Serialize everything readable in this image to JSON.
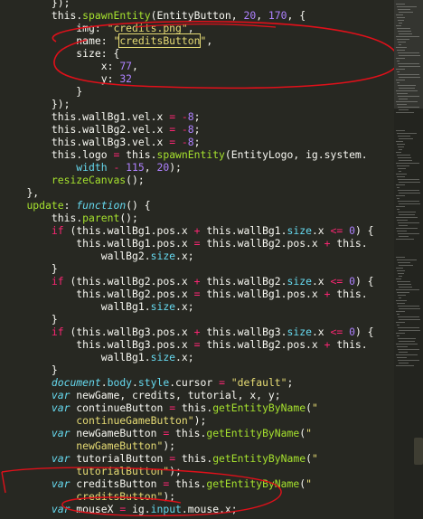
{
  "editor": {
    "lines": [
      {
        "indent": "        ",
        "tokens": [
          [
            "text",
            "});"
          ]
        ]
      },
      {
        "indent": "        ",
        "tokens": [
          [
            "this",
            "this"
          ],
          [
            "text",
            "."
          ],
          [
            "func",
            "spawnEntity"
          ],
          [
            "text",
            "(EntityButton, "
          ],
          [
            "number",
            "20"
          ],
          [
            "text",
            ", "
          ],
          [
            "number",
            "170"
          ],
          [
            "text",
            ", {"
          ]
        ]
      },
      {
        "indent": "            ",
        "tokens": [
          [
            "text",
            "img: "
          ],
          [
            "string",
            "\"credits.png\""
          ],
          [
            "text",
            ","
          ]
        ]
      },
      {
        "indent": "            ",
        "tokens": [
          [
            "text",
            "name: "
          ],
          [
            "string",
            "\""
          ],
          [
            "stringbox",
            "creditsButton"
          ],
          [
            "string",
            "\""
          ],
          [
            "text",
            ","
          ]
        ]
      },
      {
        "indent": "            ",
        "tokens": [
          [
            "text",
            "size: {"
          ]
        ]
      },
      {
        "indent": "                ",
        "tokens": [
          [
            "text",
            "x: "
          ],
          [
            "number",
            "77"
          ],
          [
            "text",
            ","
          ]
        ]
      },
      {
        "indent": "                ",
        "tokens": [
          [
            "text",
            "y: "
          ],
          [
            "number",
            "32"
          ]
        ]
      },
      {
        "indent": "            ",
        "tokens": [
          [
            "text",
            "}"
          ]
        ]
      },
      {
        "indent": "        ",
        "tokens": [
          [
            "text",
            "});"
          ]
        ]
      },
      {
        "indent": "        ",
        "tokens": [
          [
            "this",
            "this"
          ],
          [
            "text",
            ".wallBg1.vel.x "
          ],
          [
            "keyword",
            "="
          ],
          [
            "text",
            " "
          ],
          [
            "keyword",
            "-"
          ],
          [
            "number",
            "8"
          ],
          [
            "text",
            ";"
          ]
        ]
      },
      {
        "indent": "        ",
        "tokens": [
          [
            "this",
            "this"
          ],
          [
            "text",
            ".wallBg2.vel.x "
          ],
          [
            "keyword",
            "="
          ],
          [
            "text",
            " "
          ],
          [
            "keyword",
            "-"
          ],
          [
            "number",
            "8"
          ],
          [
            "text",
            ";"
          ]
        ]
      },
      {
        "indent": "        ",
        "tokens": [
          [
            "this",
            "this"
          ],
          [
            "text",
            ".wallBg3.vel.x "
          ],
          [
            "keyword",
            "="
          ],
          [
            "text",
            " "
          ],
          [
            "keyword",
            "-"
          ],
          [
            "number",
            "8"
          ],
          [
            "text",
            ";"
          ]
        ]
      },
      {
        "indent": "        ",
        "tokens": [
          [
            "this",
            "this"
          ],
          [
            "text",
            ".logo "
          ],
          [
            "keyword",
            "="
          ],
          [
            "text",
            " "
          ],
          [
            "this",
            "this"
          ],
          [
            "text",
            "."
          ],
          [
            "func",
            "spawnEntity"
          ],
          [
            "text",
            "(EntityLogo, ig.system."
          ]
        ]
      },
      {
        "indent": "            ",
        "tokens": [
          [
            "prop",
            "width"
          ],
          [
            "text",
            " "
          ],
          [
            "keyword",
            "-"
          ],
          [
            "text",
            " "
          ],
          [
            "number",
            "115"
          ],
          [
            "text",
            ", "
          ],
          [
            "number",
            "20"
          ],
          [
            "text",
            ");"
          ]
        ]
      },
      {
        "indent": "        ",
        "tokens": [
          [
            "func",
            "resizeCanvas"
          ],
          [
            "text",
            "();"
          ]
        ]
      },
      {
        "indent": "    ",
        "tokens": [
          [
            "text",
            "},"
          ]
        ]
      },
      {
        "indent": "    ",
        "tokens": [
          [
            "func",
            "update"
          ],
          [
            "text",
            ": "
          ],
          [
            "storage",
            "function"
          ],
          [
            "text",
            "() {"
          ]
        ]
      },
      {
        "indent": "        ",
        "tokens": [
          [
            "this",
            "this"
          ],
          [
            "text",
            "."
          ],
          [
            "func",
            "parent"
          ],
          [
            "text",
            "();"
          ]
        ]
      },
      {
        "indent": "        ",
        "tokens": [
          [
            "keyword",
            "if"
          ],
          [
            "text",
            " ("
          ],
          [
            "this",
            "this"
          ],
          [
            "text",
            ".wallBg1.pos.x "
          ],
          [
            "keyword",
            "+"
          ],
          [
            "text",
            " "
          ],
          [
            "this",
            "this"
          ],
          [
            "text",
            ".wallBg1."
          ],
          [
            "prop",
            "size"
          ],
          [
            "text",
            ".x "
          ],
          [
            "keyword",
            "<="
          ],
          [
            "text",
            " "
          ],
          [
            "number",
            "0"
          ],
          [
            "text",
            ") {"
          ]
        ]
      },
      {
        "indent": "            ",
        "tokens": [
          [
            "this",
            "this"
          ],
          [
            "text",
            ".wallBg1.pos.x "
          ],
          [
            "keyword",
            "="
          ],
          [
            "text",
            " "
          ],
          [
            "this",
            "this"
          ],
          [
            "text",
            ".wallBg2.pos.x "
          ],
          [
            "keyword",
            "+"
          ],
          [
            "text",
            " "
          ],
          [
            "this",
            "this"
          ],
          [
            "text",
            "."
          ]
        ]
      },
      {
        "indent": "                ",
        "tokens": [
          [
            "text",
            "wallBg2."
          ],
          [
            "prop",
            "size"
          ],
          [
            "text",
            ".x;"
          ]
        ]
      },
      {
        "indent": "        ",
        "tokens": [
          [
            "text",
            "}"
          ]
        ]
      },
      {
        "indent": "        ",
        "tokens": [
          [
            "keyword",
            "if"
          ],
          [
            "text",
            " ("
          ],
          [
            "this",
            "this"
          ],
          [
            "text",
            ".wallBg2.pos.x "
          ],
          [
            "keyword",
            "+"
          ],
          [
            "text",
            " "
          ],
          [
            "this",
            "this"
          ],
          [
            "text",
            ".wallBg2."
          ],
          [
            "prop",
            "size"
          ],
          [
            "text",
            ".x "
          ],
          [
            "keyword",
            "<="
          ],
          [
            "text",
            " "
          ],
          [
            "number",
            "0"
          ],
          [
            "text",
            ") {"
          ]
        ]
      },
      {
        "indent": "            ",
        "tokens": [
          [
            "this",
            "this"
          ],
          [
            "text",
            ".wallBg2.pos.x "
          ],
          [
            "keyword",
            "="
          ],
          [
            "text",
            " "
          ],
          [
            "this",
            "this"
          ],
          [
            "text",
            ".wallBg1.pos.x "
          ],
          [
            "keyword",
            "+"
          ],
          [
            "text",
            " "
          ],
          [
            "this",
            "this"
          ],
          [
            "text",
            "."
          ]
        ]
      },
      {
        "indent": "                ",
        "tokens": [
          [
            "text",
            "wallBg1."
          ],
          [
            "prop",
            "size"
          ],
          [
            "text",
            ".x;"
          ]
        ]
      },
      {
        "indent": "        ",
        "tokens": [
          [
            "text",
            "}"
          ]
        ]
      },
      {
        "indent": "        ",
        "tokens": [
          [
            "keyword",
            "if"
          ],
          [
            "text",
            " ("
          ],
          [
            "this",
            "this"
          ],
          [
            "text",
            ".wallBg3.pos.x "
          ],
          [
            "keyword",
            "+"
          ],
          [
            "text",
            " "
          ],
          [
            "this",
            "this"
          ],
          [
            "text",
            ".wallBg3."
          ],
          [
            "prop",
            "size"
          ],
          [
            "text",
            ".x "
          ],
          [
            "keyword",
            "<="
          ],
          [
            "text",
            " "
          ],
          [
            "number",
            "0"
          ],
          [
            "text",
            ") {"
          ]
        ]
      },
      {
        "indent": "            ",
        "tokens": [
          [
            "this",
            "this"
          ],
          [
            "text",
            ".wallBg3.pos.x "
          ],
          [
            "keyword",
            "="
          ],
          [
            "text",
            " "
          ],
          [
            "this",
            "this"
          ],
          [
            "text",
            ".wallBg2.pos.x "
          ],
          [
            "keyword",
            "+"
          ],
          [
            "text",
            " "
          ],
          [
            "this",
            "this"
          ],
          [
            "text",
            "."
          ]
        ]
      },
      {
        "indent": "                ",
        "tokens": [
          [
            "text",
            "wallBg1."
          ],
          [
            "prop",
            "size"
          ],
          [
            "text",
            ".x;"
          ]
        ]
      },
      {
        "indent": "        ",
        "tokens": [
          [
            "text",
            "}"
          ]
        ]
      },
      {
        "indent": "        ",
        "tokens": [
          [
            "storage",
            "document"
          ],
          [
            "text",
            "."
          ],
          [
            "prop",
            "body"
          ],
          [
            "text",
            "."
          ],
          [
            "prop",
            "style"
          ],
          [
            "text",
            ".cursor "
          ],
          [
            "keyword",
            "="
          ],
          [
            "text",
            " "
          ],
          [
            "string",
            "\"default\""
          ],
          [
            "text",
            ";"
          ]
        ]
      },
      {
        "indent": "        ",
        "tokens": [
          [
            "storage",
            "var"
          ],
          [
            "text",
            " newGame, credits, tutorial, x, y;"
          ]
        ]
      },
      {
        "indent": "        ",
        "tokens": [
          [
            "storage",
            "var"
          ],
          [
            "text",
            " continueButton "
          ],
          [
            "keyword",
            "="
          ],
          [
            "text",
            " "
          ],
          [
            "this",
            "this"
          ],
          [
            "text",
            "."
          ],
          [
            "func",
            "getEntityByName"
          ],
          [
            "text",
            "("
          ],
          [
            "string",
            "\""
          ]
        ]
      },
      {
        "indent": "            ",
        "tokens": [
          [
            "string",
            "continueGameButton\""
          ],
          [
            "text",
            ");"
          ]
        ]
      },
      {
        "indent": "        ",
        "tokens": [
          [
            "storage",
            "var"
          ],
          [
            "text",
            " newGameButton "
          ],
          [
            "keyword",
            "="
          ],
          [
            "text",
            " "
          ],
          [
            "this",
            "this"
          ],
          [
            "text",
            "."
          ],
          [
            "func",
            "getEntityByName"
          ],
          [
            "text",
            "("
          ],
          [
            "string",
            "\""
          ]
        ]
      },
      {
        "indent": "            ",
        "tokens": [
          [
            "string",
            "newGameButton\""
          ],
          [
            "text",
            ");"
          ]
        ]
      },
      {
        "indent": "        ",
        "tokens": [
          [
            "storage",
            "var"
          ],
          [
            "text",
            " tutorialButton "
          ],
          [
            "keyword",
            "="
          ],
          [
            "text",
            " "
          ],
          [
            "this",
            "this"
          ],
          [
            "text",
            "."
          ],
          [
            "func",
            "getEntityByName"
          ],
          [
            "text",
            "("
          ],
          [
            "string",
            "\""
          ]
        ]
      },
      {
        "indent": "            ",
        "tokens": [
          [
            "string",
            "tutorialButton\""
          ],
          [
            "text",
            ");"
          ]
        ]
      },
      {
        "indent": "        ",
        "tokens": [
          [
            "storage",
            "var"
          ],
          [
            "text",
            " creditsButton "
          ],
          [
            "keyword",
            "="
          ],
          [
            "text",
            " "
          ],
          [
            "this",
            "this"
          ],
          [
            "text",
            "."
          ],
          [
            "func",
            "getEntityByName"
          ],
          [
            "text",
            "("
          ],
          [
            "string",
            "\""
          ]
        ]
      },
      {
        "indent": "            ",
        "tokens": [
          [
            "string",
            "creditsButton\""
          ],
          [
            "text",
            ");"
          ]
        ]
      },
      {
        "indent": "        ",
        "tokens": [
          [
            "storage",
            "var"
          ],
          [
            "text",
            " mouseX "
          ],
          [
            "keyword",
            "="
          ],
          [
            "text",
            " ig."
          ],
          [
            "prop",
            "input"
          ],
          [
            "text",
            ".mouse.x;"
          ]
        ]
      }
    ]
  },
  "colors": {
    "background": "#272822",
    "annotation": "#e0101a"
  }
}
